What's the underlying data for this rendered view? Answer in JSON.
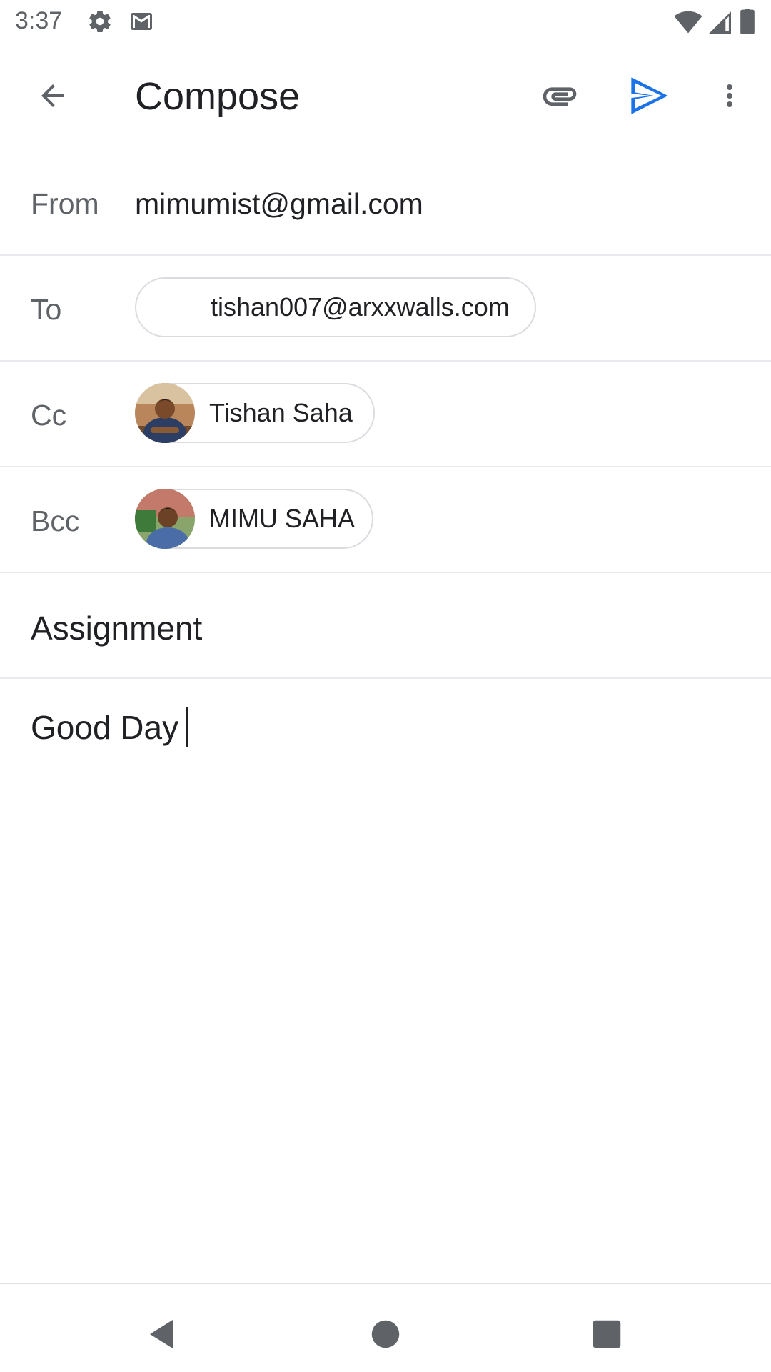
{
  "status_bar": {
    "time": "3:37",
    "icons_left": [
      "gear-icon",
      "mail-icon"
    ],
    "icons_right": [
      "wifi-icon",
      "cell-signal-icon",
      "battery-icon"
    ]
  },
  "app_bar": {
    "title": "Compose",
    "actions": [
      "back-arrow-icon",
      "attach-icon",
      "send-icon",
      "more-vert-icon"
    ],
    "accent_color": "#1a73e8"
  },
  "compose": {
    "from": {
      "label": "From",
      "value": "mimumist@gmail.com"
    },
    "to": {
      "label": "To",
      "recipients": [
        "tishan007@arxxwalls.com"
      ]
    },
    "cc": {
      "label": "Cc",
      "recipients": [
        {
          "name": "Tishan Saha",
          "avatar": "photo"
        }
      ]
    },
    "bcc": {
      "label": "Bcc",
      "recipients": [
        {
          "name": "MIMU SAHA",
          "avatar": "photo"
        }
      ]
    },
    "subject": "Assignment",
    "body": "Good Day"
  },
  "nav_bar": {
    "buttons": [
      "nav-back-icon",
      "nav-home-icon",
      "nav-recents-icon"
    ]
  }
}
